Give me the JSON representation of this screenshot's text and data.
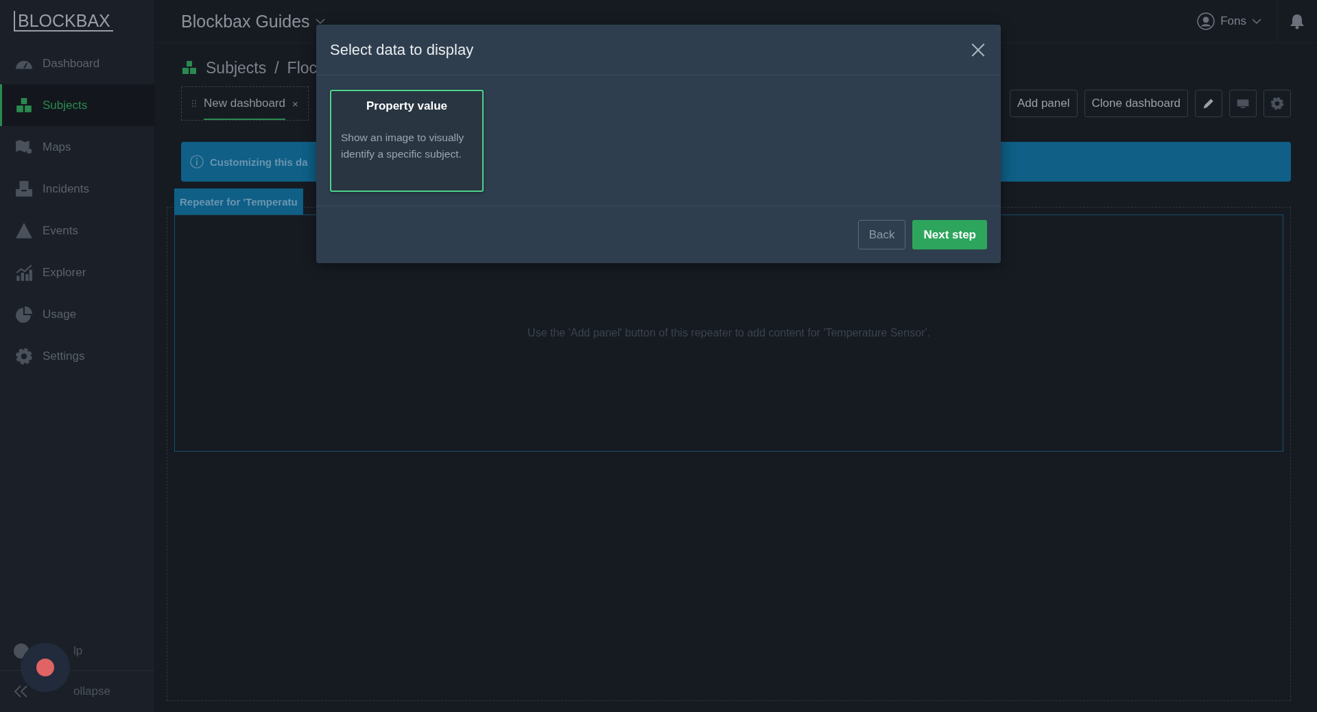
{
  "app": {
    "logo": "BLOCKBAX",
    "workspace": "Blockbax Guides",
    "user": "Fons"
  },
  "sidebar": {
    "items": [
      {
        "label": "Dashboard",
        "selected": false
      },
      {
        "label": "Subjects",
        "selected": true
      },
      {
        "label": "Maps",
        "selected": false
      },
      {
        "label": "Incidents",
        "selected": false
      },
      {
        "label": "Events",
        "selected": false
      },
      {
        "label": "Explorer",
        "selected": false
      },
      {
        "label": "Usage",
        "selected": false
      },
      {
        "label": "Settings",
        "selected": false
      }
    ],
    "help": "lp",
    "collapse": "ollapse"
  },
  "breadcrumb": {
    "items": [
      "Subjects",
      "Floc"
    ],
    "separator": "/"
  },
  "dashboard_tabs": [
    {
      "label": "New dashboard",
      "close": "×",
      "selected": true
    }
  ],
  "toolbar": {
    "buttons": [
      "Add panel",
      "Clone dashboard"
    ]
  },
  "banner": {
    "text": "Customizing this da"
  },
  "repeater": {
    "title": "Repeater for 'Temperatu",
    "message": "Use the 'Add panel' button of this repeater to add content for 'Temperature Sensor'."
  },
  "modal": {
    "title": "Select data to display",
    "options": [
      {
        "title": "Property value",
        "description": "Show an image to visually identify a specific subject.",
        "selected": true
      }
    ],
    "buttons": [
      {
        "label": "Back",
        "kind": "secondary"
      },
      {
        "label": "Next step",
        "kind": "primary"
      }
    ]
  }
}
